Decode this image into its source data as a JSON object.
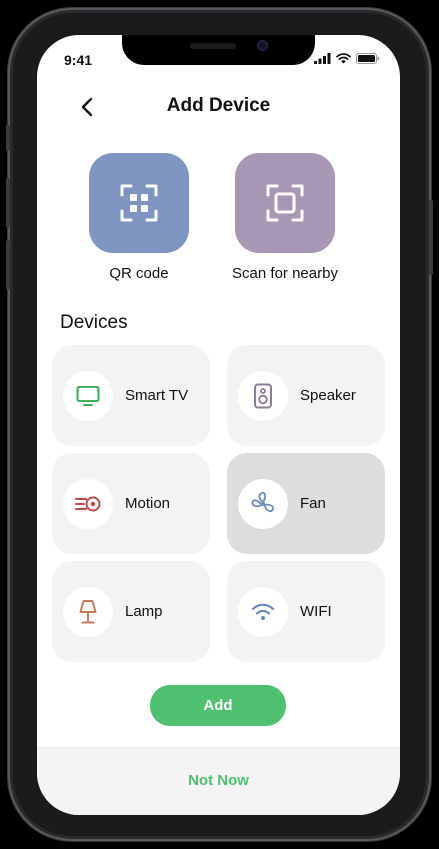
{
  "status_bar": {
    "time": "9:41",
    "signal_icon": "cellular-signal-icon",
    "wifi_icon": "wifi-status-icon",
    "battery_icon": "battery-icon"
  },
  "header": {
    "title": "Add Device",
    "back_icon": "chevron-left-icon"
  },
  "actions": [
    {
      "label": "QR code",
      "icon": "qr-scan-icon",
      "color": "#7e95c1"
    },
    {
      "label": "Scan for nearby",
      "icon": "scan-frame-icon",
      "color": "#a896b5"
    }
  ],
  "devices_section": {
    "title": "Devices",
    "items": [
      {
        "label": "Smart TV",
        "icon": "tv-icon",
        "icon_color": "#3dae5b",
        "selected": false
      },
      {
        "label": "Speaker",
        "icon": "speaker-icon",
        "icon_color": "#8e7d98",
        "selected": false
      },
      {
        "label": "Motion",
        "icon": "motion-sensor-icon",
        "icon_color": "#c4483f",
        "selected": false
      },
      {
        "label": "Fan",
        "icon": "fan-icon",
        "icon_color": "#6d8bbf",
        "selected": true
      },
      {
        "label": "Lamp",
        "icon": "lamp-icon",
        "icon_color": "#c97a5b",
        "selected": false
      },
      {
        "label": "WIFI",
        "icon": "wifi-icon",
        "icon_color": "#6d8bbf",
        "selected": false
      }
    ]
  },
  "buttons": {
    "add_label": "Add",
    "not_now_label": "Not Now",
    "accent_color": "#4ec06f"
  }
}
